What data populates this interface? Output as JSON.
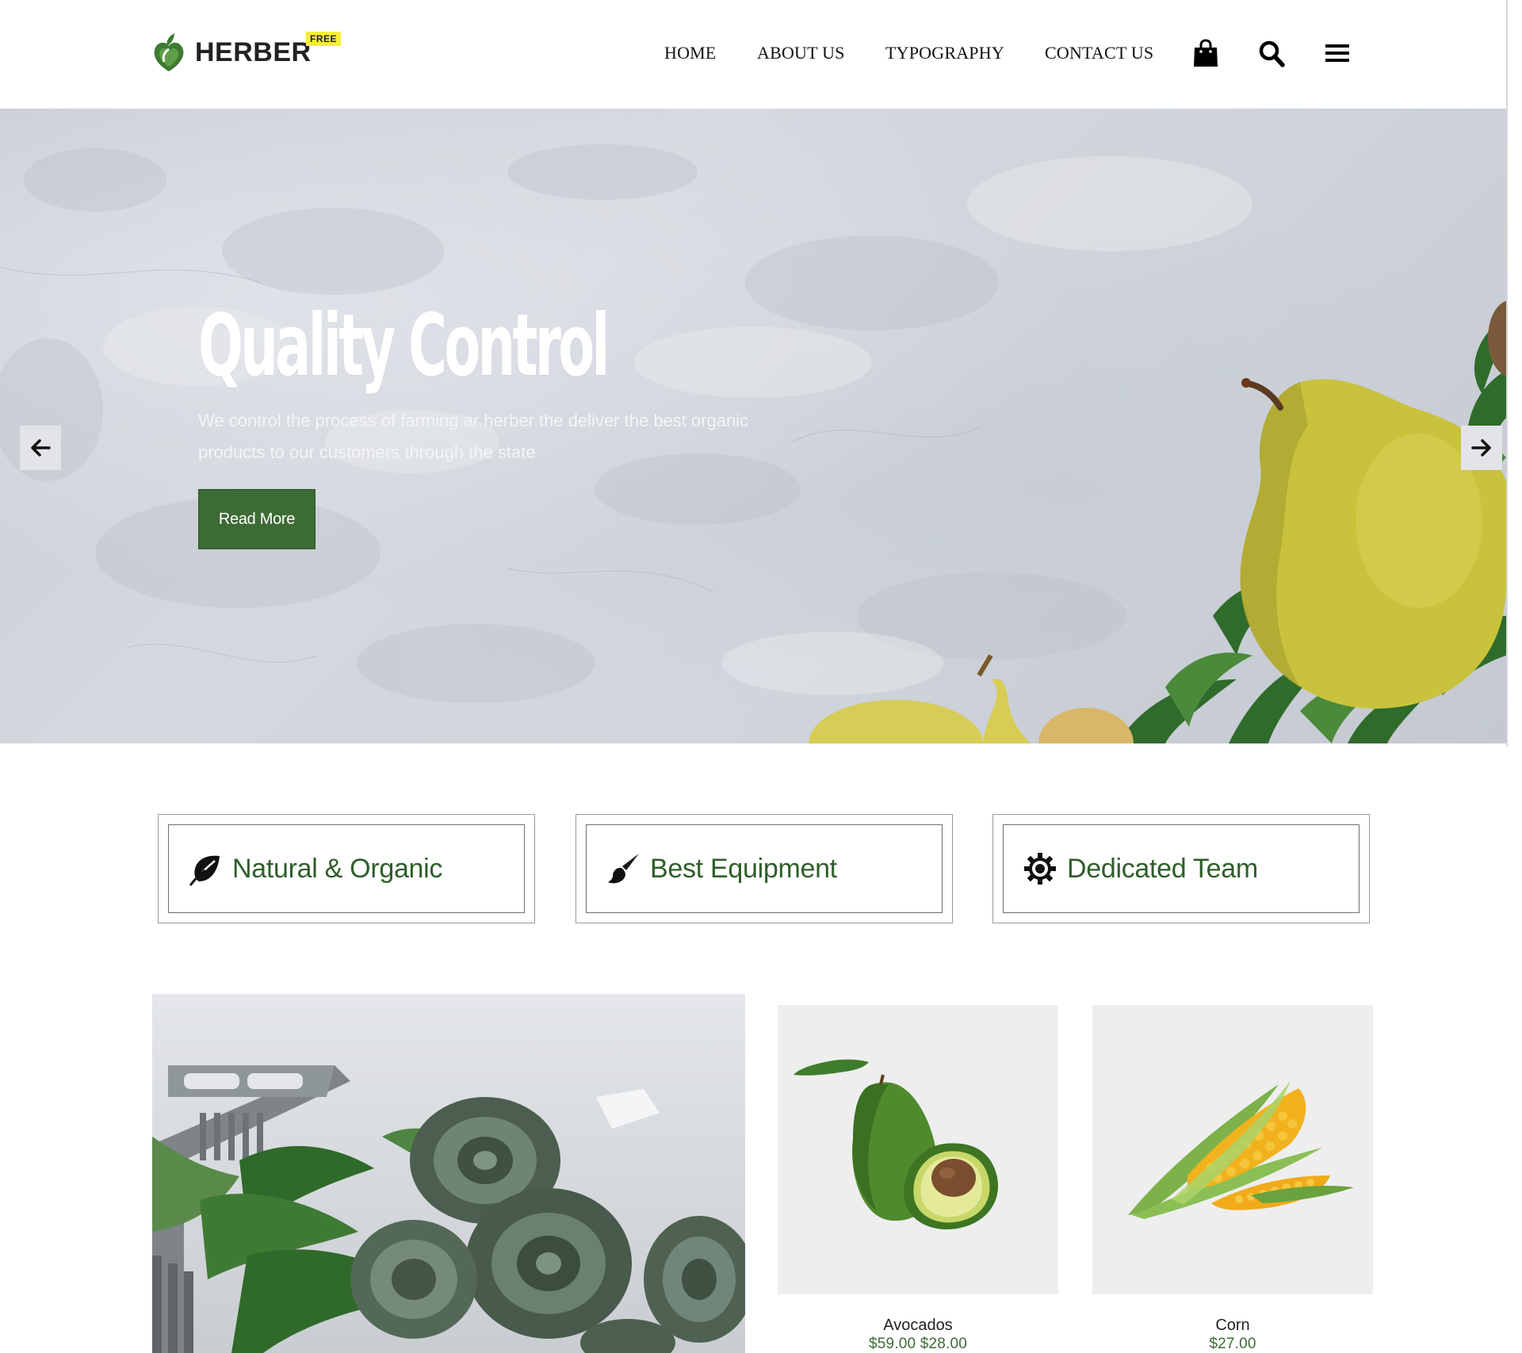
{
  "brand": {
    "name": "HERBER",
    "badge": "FREE",
    "color": "#3d6b35"
  },
  "nav": {
    "items": [
      {
        "label": "HOME"
      },
      {
        "label": "ABOUT US"
      },
      {
        "label": "TYPOGRAPHY"
      },
      {
        "label": "CONTACT US"
      }
    ],
    "icons": [
      "shopping-bag-icon",
      "search-icon",
      "menu-icon"
    ]
  },
  "hero": {
    "title": "Quality Control",
    "subtitle": "We control the process of farming ar herber the deliver the best organic products to our customers through the state",
    "cta_label": "Read More",
    "prev_icon": "arrow-left-icon",
    "next_icon": "arrow-right-icon"
  },
  "features": [
    {
      "label": "Natural & Organic",
      "icon": "leaf-icon"
    },
    {
      "label": "Best Equipment",
      "icon": "brush-icon"
    },
    {
      "label": "Dedicated Team",
      "icon": "gear-icon"
    }
  ],
  "products": [
    {
      "name": "Avocados",
      "price": "$59.00 $28.00"
    },
    {
      "name": "Corn",
      "price": "$27.00"
    }
  ],
  "colors": {
    "accent": "#3d6b35",
    "feature_text": "#2f5e2b",
    "badge": "#f6ee3b"
  }
}
